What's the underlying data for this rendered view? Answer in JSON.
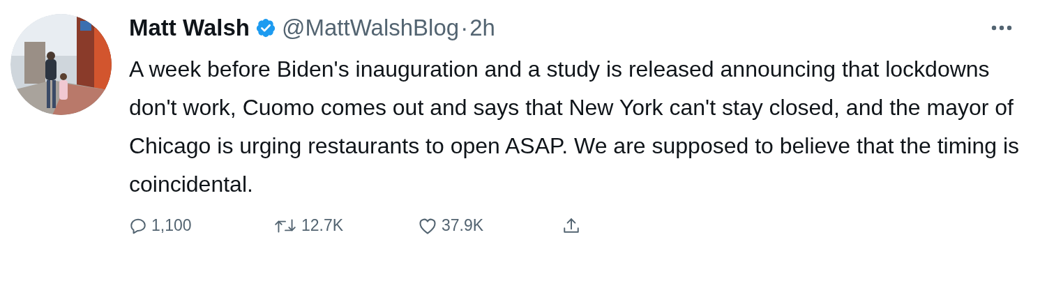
{
  "tweet": {
    "author": {
      "name": "Matt Walsh",
      "verified": true,
      "handle": "@MattWalshBlog",
      "separator": "·",
      "time": "2h"
    },
    "text": "A week before Biden's inauguration and a study is released announcing that lockdowns don't work, Cuomo comes out and says that New York can't stay closed, and the mayor of Chicago is urging restaurants to open ASAP. We are supposed to believe that the timing is coincidental.",
    "actions": [
      {
        "kind": "reply",
        "count": "1,100"
      },
      {
        "kind": "retweet",
        "count": "12.7K"
      },
      {
        "kind": "like",
        "count": "37.9K"
      },
      {
        "kind": "share"
      }
    ]
  }
}
